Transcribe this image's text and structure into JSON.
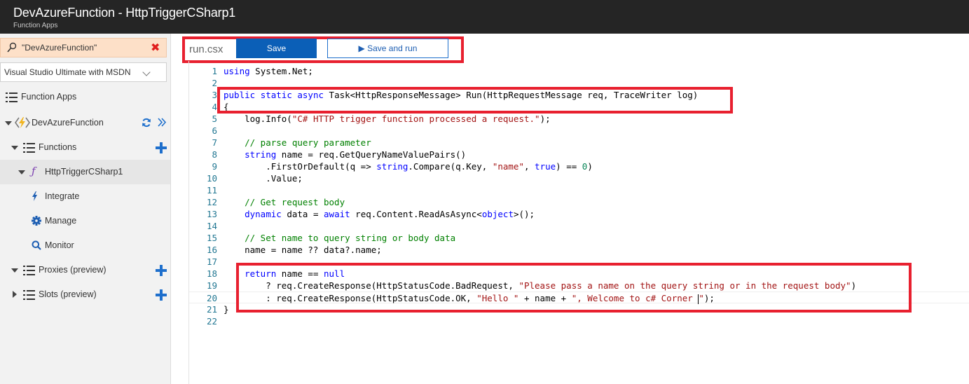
{
  "header": {
    "title": "DevAzureFunction - HttpTriggerCSharp1",
    "subtitle": "Function Apps"
  },
  "sidebar": {
    "search_value": "\"DevAzureFunction\"",
    "subscription": "Visual Studio Ultimate with MSDN",
    "items": [
      {
        "label": "Function Apps"
      },
      {
        "label": "DevAzureFunction"
      },
      {
        "label": "Functions"
      },
      {
        "label": "HttpTriggerCSharp1"
      },
      {
        "label": "Integrate"
      },
      {
        "label": "Manage"
      },
      {
        "label": "Monitor"
      },
      {
        "label": "Proxies (preview)"
      },
      {
        "label": "Slots (preview)"
      }
    ]
  },
  "toolbar": {
    "filename": "run.csx",
    "save_label": "Save",
    "save_run_label": "Save and run"
  },
  "editor": {
    "line_numbers": [
      "1",
      "2",
      "3",
      "4",
      "5",
      "6",
      "7",
      "8",
      "9",
      "10",
      "11",
      "12",
      "13",
      "14",
      "15",
      "16",
      "17",
      "18",
      "19",
      "20",
      "21",
      "22"
    ],
    "tokens": {
      "l1": [
        "using",
        " System.Net;"
      ],
      "l3": [
        "public",
        " ",
        "static",
        " ",
        "async",
        " Task<HttpResponseMessage> Run(HttpRequestMessage req, TraceWriter log)"
      ],
      "l4": [
        "{"
      ],
      "l5": [
        "    log.Info(",
        "\"C# HTTP trigger function processed a request.\"",
        ");"
      ],
      "l7": [
        "    // parse query parameter"
      ],
      "l8": [
        "    ",
        "string",
        " name = req.GetQueryNameValuePairs()"
      ],
      "l9": [
        "        .FirstOrDefault(q => ",
        "string",
        ".Compare(q.Key, ",
        "\"name\"",
        ", ",
        "true",
        ") == ",
        "0",
        ")"
      ],
      "l10": [
        "        .Value;"
      ],
      "l12": [
        "    // Get request body"
      ],
      "l13": [
        "    ",
        "dynamic",
        " data = ",
        "await",
        " req.Content.ReadAsAsync<",
        "object",
        ">();"
      ],
      "l15": [
        "    // Set name to query string or body data"
      ],
      "l16": [
        "    name = name ?? data?.name;"
      ],
      "l18": [
        "    ",
        "return",
        " name == ",
        "null"
      ],
      "l19": [
        "        ? req.CreateResponse(HttpStatusCode.BadRequest, ",
        "\"Please pass a name on the query string or in the request body\"",
        ")"
      ],
      "l20": [
        "        : req.CreateResponse(HttpStatusCode.OK, ",
        "\"Hello \"",
        " + name + ",
        "\", Welcome to c# Corner ",
        "\"",
        ");"
      ],
      "l21": [
        "}"
      ]
    }
  },
  "colors": {
    "topbar": "#252525",
    "accent": "#0b5fb7",
    "highlight": "#e8202f",
    "keyword": "#0000ff",
    "string": "#a31515",
    "comment": "#008000"
  }
}
